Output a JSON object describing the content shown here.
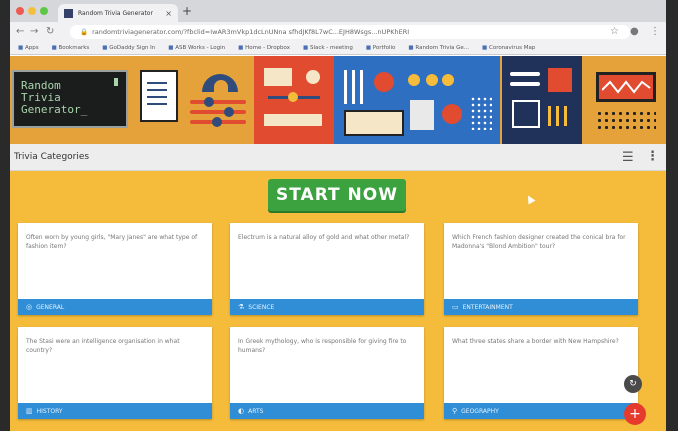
{
  "browser": {
    "tab_title": "Random Trivia Generator",
    "tab_close": "×",
    "new_tab": "+",
    "url": "randomtriviagenerator.com/?fbclid=IwAR3mVkp1dcLnUNna sfhdJKf8L7wC...EJH8Wsgs...nUPKhERI",
    "bookmarks": [
      "Apps",
      "Bookmarks",
      "GoDaddy Sign In",
      "ASB Works - Login",
      "Home - Dropbox",
      "Slack - meeting",
      "Portfolio",
      "Random Trivia Ge...",
      "Coronavirus Map"
    ]
  },
  "banner": {
    "logo_text": "Random\nTrivia\nGenerator_"
  },
  "header": {
    "title": "Trivia Categories"
  },
  "main": {
    "start_label": "START NOW",
    "cards": [
      {
        "question": "Often worn by young girls, \"Mary Janes\" are what type of fashion item?",
        "category": "GENERAL",
        "icon": "globe-icon"
      },
      {
        "question": "Electrum is a natural alloy of gold and what other metal?",
        "category": "SCIENCE",
        "icon": "flask-icon"
      },
      {
        "question": "Which French fashion designer created the conical bra for Madonna's \"Blond Ambition\" tour?",
        "category": "ENTERTAINMENT",
        "icon": "tv-icon"
      },
      {
        "question": "The Stasi were an intelligence organisation in what country?",
        "category": "HISTORY",
        "icon": "column-icon"
      },
      {
        "question": "In Greek mythology, who is responsible for giving fire to humans?",
        "category": "ARTS",
        "icon": "palette-icon"
      },
      {
        "question": "What three states share a border with New Hampshire?",
        "category": "GEOGRAPHY",
        "icon": "map-pin-icon"
      }
    ]
  },
  "colors": {
    "banner": "#e6a23a",
    "main_bg": "#f5bc3b",
    "start_button": "#3ca23f",
    "card_footer": "#2f8ed6",
    "fab": "#e53a2c"
  }
}
